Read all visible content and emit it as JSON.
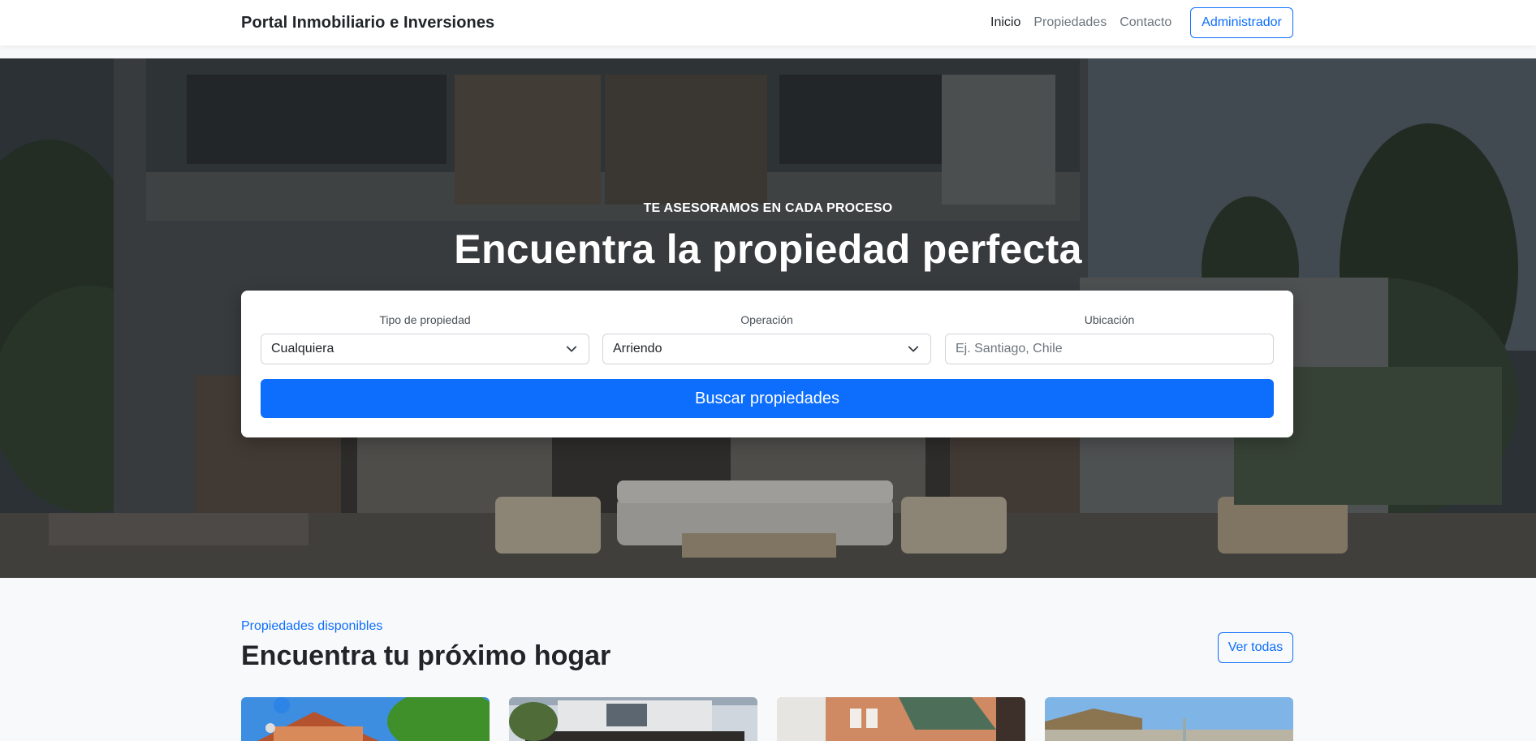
{
  "navbar": {
    "brand": "Portal Inmobiliario e Inversiones",
    "links": [
      {
        "label": "Inicio",
        "active": true
      },
      {
        "label": "Propiedades",
        "active": false
      },
      {
        "label": "Contacto",
        "active": false
      }
    ],
    "admin_label": "Administrador"
  },
  "hero": {
    "eyebrow": "TE ASESORAMOS EN CADA PROCESO",
    "title": "Encuentra la propiedad perfecta"
  },
  "search": {
    "type_label": "Tipo de propiedad",
    "type_value": "Cualquiera",
    "operation_label": "Operación",
    "operation_value": "Arriendo",
    "location_label": "Ubicación",
    "location_placeholder": "Ej. Santiago, Chile",
    "button_label": "Buscar propiedades"
  },
  "listings": {
    "eyebrow": "Propiedades disponibles",
    "title": "Encuentra tu próximo hogar",
    "view_all_label": "Ver todas"
  },
  "colors": {
    "primary": "#0d6efd",
    "text_dark": "#212529",
    "text_muted": "#6c757d",
    "section_bg": "#f8f9fa"
  }
}
